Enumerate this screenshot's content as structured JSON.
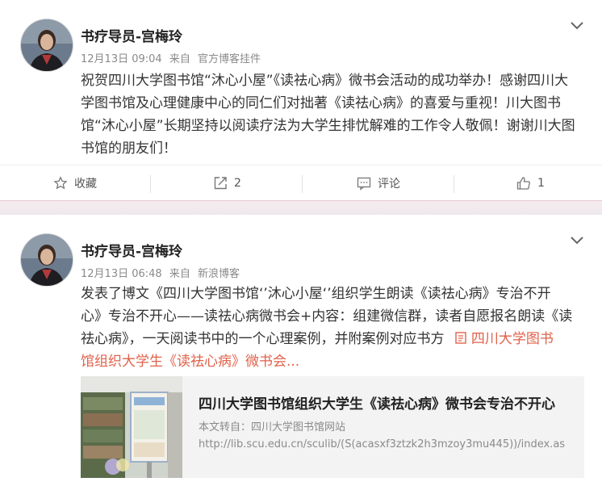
{
  "posts": [
    {
      "author": "书疗导员-宫梅玲",
      "time": "12月13日 09:04",
      "from_prefix": "来自",
      "source": "官方博客挂件",
      "lines": [
        "祝贺四川大学图书馆“沐心小屋”《读祛心病》微书会活动的成功举办！感谢四川大",
        "学图书馆及心理健康中心的同仁们对拙著《读祛心病》的喜爱与重视！川大图书",
        "馆“沐心小屋”长期坚持以阅读疗法为大学生排忧解难的工作令人敬佩！谢谢川大图",
        "书馆的朋友们！"
      ],
      "actions": {
        "favorite": "收藏",
        "repost_count": "2",
        "comment": "评论",
        "like_count": "1"
      }
    },
    {
      "author": "书疗导员-宫梅玲",
      "time": "12月13日 06:48",
      "from_prefix": "来自",
      "source": "新浪博客",
      "lines": [
        "发表了博文《四川大学图书馆‘’沐心小屋‘’组织学生朗读《读祛心病》专治不开",
        "心》专治不开心——读祛心病微书会+内容：组建微信群，读者自愿报名朗读《读",
        "祛心病》，一天阅读书中的一个心理案例，并附案例对应书方"
      ],
      "link_inline_1": "四川大学图书",
      "link_inline_2": "馆组织大学生《读祛心病》微书会...",
      "card": {
        "title": "四川大学图书馆组织大学生《读祛心病》微书会专治不开心",
        "source": "本文转自：四川大学图书馆网站",
        "url": "http://lib.scu.edu.cn/sculib/(S(acasxf3ztzk2h3mzoy3mu445))/index.as"
      }
    }
  ],
  "colors": {
    "link": "#e0624a",
    "meta": "#8a8a8a",
    "background": "#f2f2f5"
  },
  "icons": [
    "chevron-down-icon",
    "star-icon",
    "repost-icon",
    "comment-icon",
    "like-icon",
    "article-icon"
  ]
}
